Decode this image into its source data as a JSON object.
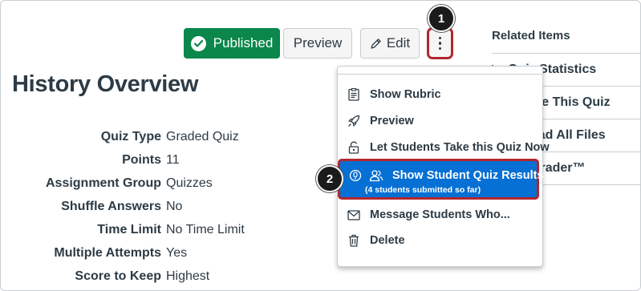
{
  "toolbar": {
    "published_label": "Published",
    "preview_label": "Preview",
    "edit_label": "Edit"
  },
  "callouts": {
    "first": "1",
    "second": "2"
  },
  "page": {
    "title": "History Overview"
  },
  "details": [
    {
      "label": "Quiz Type",
      "value": "Graded Quiz"
    },
    {
      "label": "Points",
      "value": "11"
    },
    {
      "label": "Assignment Group",
      "value": "Quizzes"
    },
    {
      "label": "Shuffle Answers",
      "value": "No"
    },
    {
      "label": "Time Limit",
      "value": "No Time Limit"
    },
    {
      "label": "Multiple Attempts",
      "value": "Yes"
    },
    {
      "label": "Score to Keep",
      "value": "Highest"
    }
  ],
  "sidebar": {
    "heading": "Related Items",
    "items": [
      {
        "label": "Quiz Statistics",
        "icon": "chart-icon"
      },
      {
        "label": "Moderate This Quiz"
      },
      {
        "label": "Download All Files"
      },
      {
        "label": "SpeedGrader™"
      }
    ]
  },
  "menu": {
    "items": [
      {
        "label": "Show Rubric",
        "icon": "rubric-icon"
      },
      {
        "label": "Preview",
        "icon": "rocket-icon"
      },
      {
        "label": "Let Students Take this Quiz Now",
        "icon": "unlock-icon"
      },
      {
        "label": "Show Student Quiz Results",
        "sub": "(4 students submitted so far)",
        "icon": "users-icon",
        "highlighted": true
      },
      {
        "label": "Message Students Who...",
        "icon": "envelope-icon"
      },
      {
        "label": "Delete",
        "icon": "trash-icon"
      }
    ]
  },
  "colors": {
    "published": "#0b874b",
    "highlight": "#0770d4",
    "callout_border": "#b3262d",
    "text": "#2d3b45"
  }
}
